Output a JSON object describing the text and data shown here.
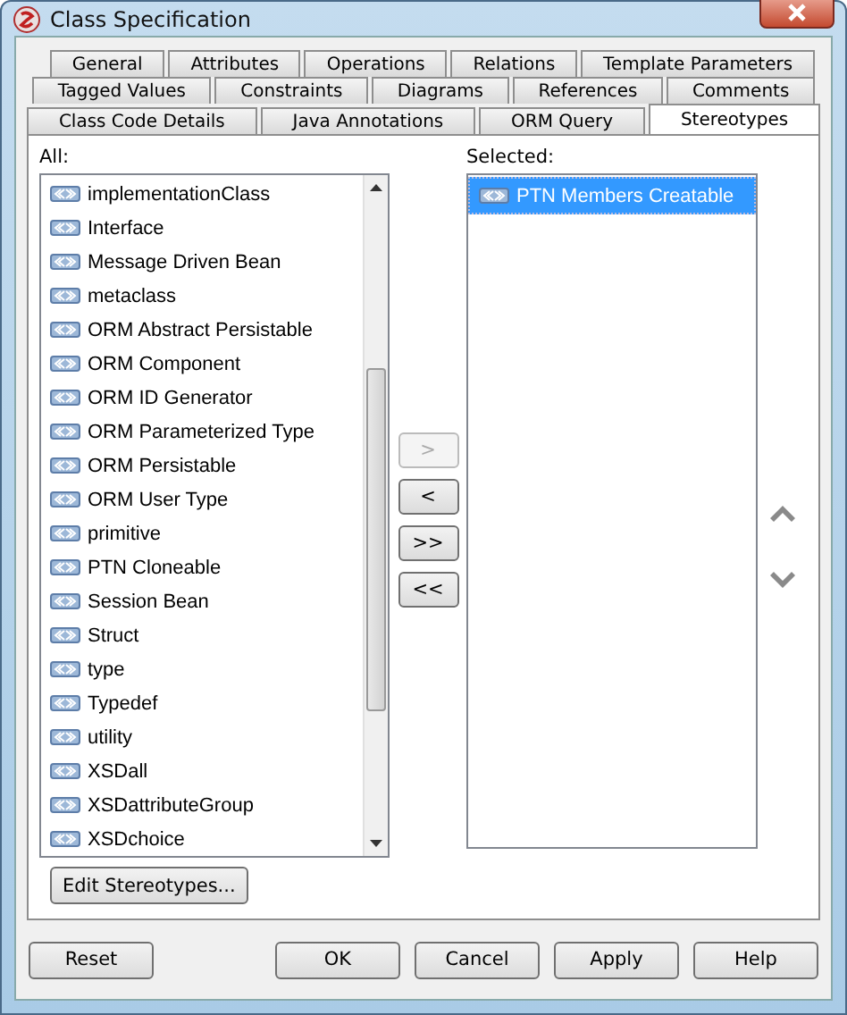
{
  "window": {
    "title": "Class Specification"
  },
  "tab_rows": [
    [
      {
        "label": "General",
        "selected": false
      },
      {
        "label": "Attributes",
        "selected": false
      },
      {
        "label": "Operations",
        "selected": false
      },
      {
        "label": "Relations",
        "selected": false
      },
      {
        "label": "Template Parameters",
        "selected": false
      }
    ],
    [
      {
        "label": "Tagged Values",
        "selected": false
      },
      {
        "label": "Constraints",
        "selected": false
      },
      {
        "label": "Diagrams",
        "selected": false
      },
      {
        "label": "References",
        "selected": false
      },
      {
        "label": "Comments",
        "selected": false
      }
    ],
    [
      {
        "label": "Class Code Details",
        "selected": false
      },
      {
        "label": "Java Annotations",
        "selected": false
      },
      {
        "label": "ORM Query",
        "selected": false
      },
      {
        "label": "Stereotypes",
        "selected": true
      }
    ]
  ],
  "all_list": {
    "label": "All:",
    "items": [
      {
        "label": "implementationClass",
        "selected": false
      },
      {
        "label": "Interface",
        "selected": false
      },
      {
        "label": "Message Driven Bean",
        "selected": false
      },
      {
        "label": "metaclass",
        "selected": false
      },
      {
        "label": "ORM Abstract Persistable",
        "selected": false
      },
      {
        "label": "ORM Component",
        "selected": false
      },
      {
        "label": "ORM ID Generator",
        "selected": false
      },
      {
        "label": "ORM Parameterized Type",
        "selected": false
      },
      {
        "label": "ORM Persistable",
        "selected": false
      },
      {
        "label": "ORM User Type",
        "selected": false
      },
      {
        "label": "primitive",
        "selected": false
      },
      {
        "label": "PTN Cloneable",
        "selected": false
      },
      {
        "label": "Session Bean",
        "selected": false
      },
      {
        "label": "Struct",
        "selected": false
      },
      {
        "label": "type",
        "selected": false
      },
      {
        "label": "Typedef",
        "selected": false
      },
      {
        "label": "utility",
        "selected": false
      },
      {
        "label": "XSDall",
        "selected": false
      },
      {
        "label": "XSDattributeGroup",
        "selected": false
      },
      {
        "label": "XSDchoice",
        "selected": false
      }
    ]
  },
  "move_buttons": [
    {
      "label": ">",
      "disabled": true
    },
    {
      "label": "<",
      "disabled": false
    },
    {
      "label": ">>",
      "disabled": false
    },
    {
      "label": "<<",
      "disabled": false
    }
  ],
  "selected_list": {
    "label": "Selected:",
    "items": [
      {
        "label": "PTN Members Creatable",
        "selected": true
      }
    ]
  },
  "edit_button": "Edit Stereotypes...",
  "footer_left": "Reset",
  "footer_buttons": [
    "OK",
    "Cancel",
    "Apply",
    "Help"
  ]
}
